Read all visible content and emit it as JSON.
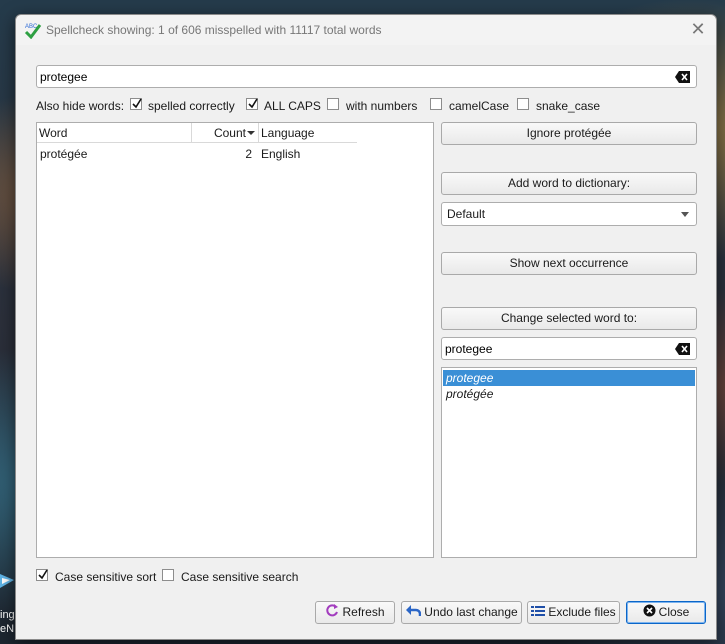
{
  "window": {
    "title": "Spellcheck showing: 1 of 606 misspelled with 11117 total words"
  },
  "filter": {
    "value": "protegee"
  },
  "hide_words": {
    "label": "Also hide words:",
    "options": [
      {
        "label": "spelled correctly",
        "checked": true
      },
      {
        "label": "ALL CAPS",
        "checked": true
      },
      {
        "label": "with numbers",
        "checked": false
      },
      {
        "label": "camelCase",
        "checked": false
      },
      {
        "label": "snake_case",
        "checked": false
      }
    ]
  },
  "table": {
    "headers": {
      "word": "Word",
      "count": "Count",
      "language": "Language"
    },
    "sort_column": "Count",
    "rows": [
      {
        "word": "protégée",
        "count": "2",
        "language": "English"
      }
    ]
  },
  "actions": {
    "ignore": "Ignore protégée",
    "add_word": "Add word to dictionary:",
    "dictionary": "Default",
    "show_next": "Show next occurrence",
    "change_to": "Change selected word to:",
    "replacement": "protegee",
    "suggestions": [
      "protegee",
      "protégée"
    ],
    "selected_suggestion": 0
  },
  "bottom": {
    "case_sort": {
      "label": "Case sensitive sort",
      "checked": true
    },
    "case_search": {
      "label": "Case sensitive search",
      "checked": false
    }
  },
  "buttons": {
    "refresh": "Refresh",
    "undo": "Undo last change",
    "exclude": "Exclude files",
    "close": "Close"
  },
  "desktop": {
    "label": "ing eNA"
  },
  "colors": {
    "selection": "#3a8fd6",
    "default_button_border": "#0b66c8",
    "check_green": "#2ea043"
  }
}
